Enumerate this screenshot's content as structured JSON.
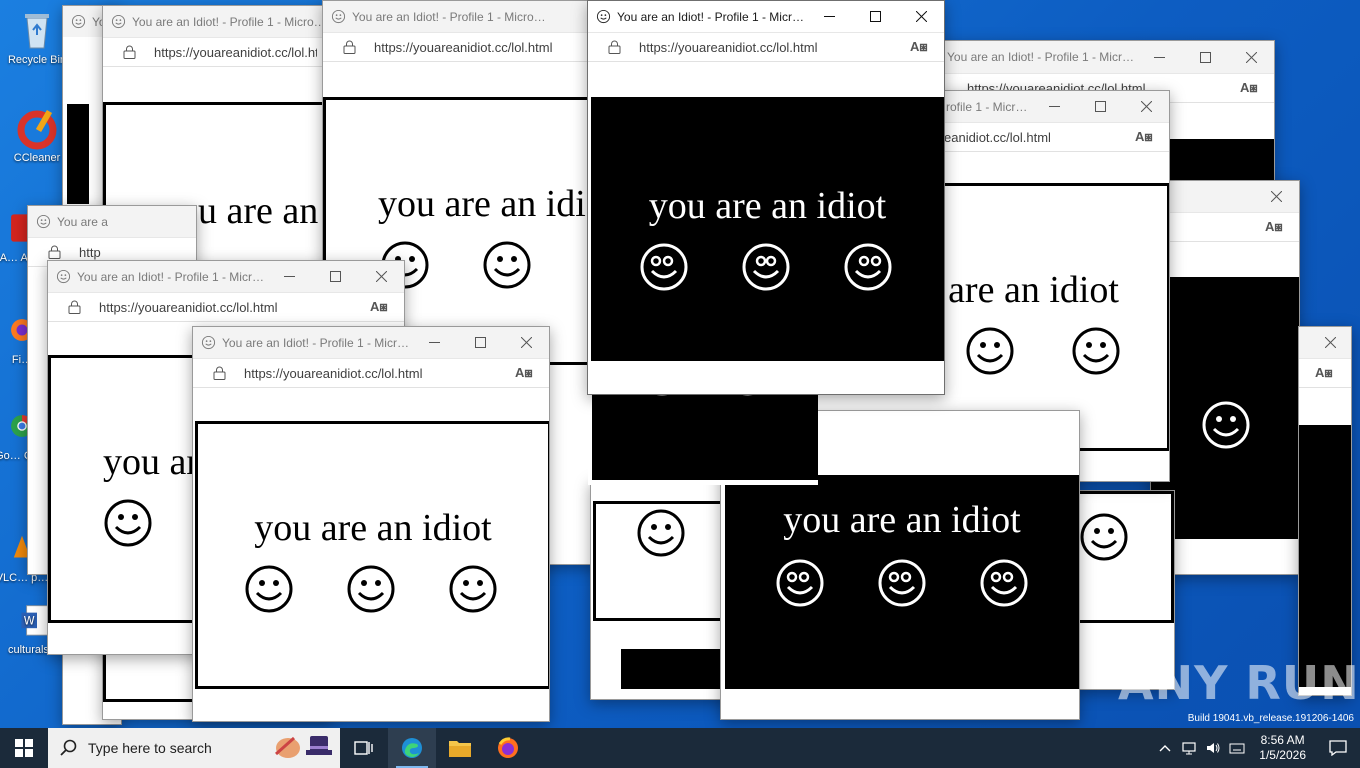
{
  "desktop_icons": [
    {
      "name": "recycle-bin",
      "label": "Recycle Bin"
    },
    {
      "name": "ccleaner",
      "label": "CCleaner"
    },
    {
      "name": "acrobat",
      "label": "A… Ac…"
    },
    {
      "name": "firefox",
      "label": "Fi…"
    },
    {
      "name": "chrome",
      "label": "Go… Ch…"
    },
    {
      "name": "vlc",
      "label": "VLC… p…"
    },
    {
      "name": "word-doc",
      "label": "culturalsu…"
    }
  ],
  "window": {
    "title": "You are an Idiot! - Profile 1 - Micro…",
    "url": "https://youareanidiot.cc/lol.html",
    "message": "you are an idiot"
  },
  "partial_labels": {
    "title_short": "You are an Idiot!",
    "url_partial_right": "eanidiot.cc/lol.html",
    "url_partial_http": "http",
    "title_partial": "rofile 1 - Micro...",
    "title_partial2": "You are a",
    "title_partial3": "You are an Idiot! - Profile 1 - Micro..."
  },
  "taskbar": {
    "search_placeholder": "Type here to search",
    "time": "8:56 AM",
    "date": "1/5/2026"
  },
  "watermark": "ANY RUN",
  "build_text": "Build 19041.vb_release.191206-1406"
}
